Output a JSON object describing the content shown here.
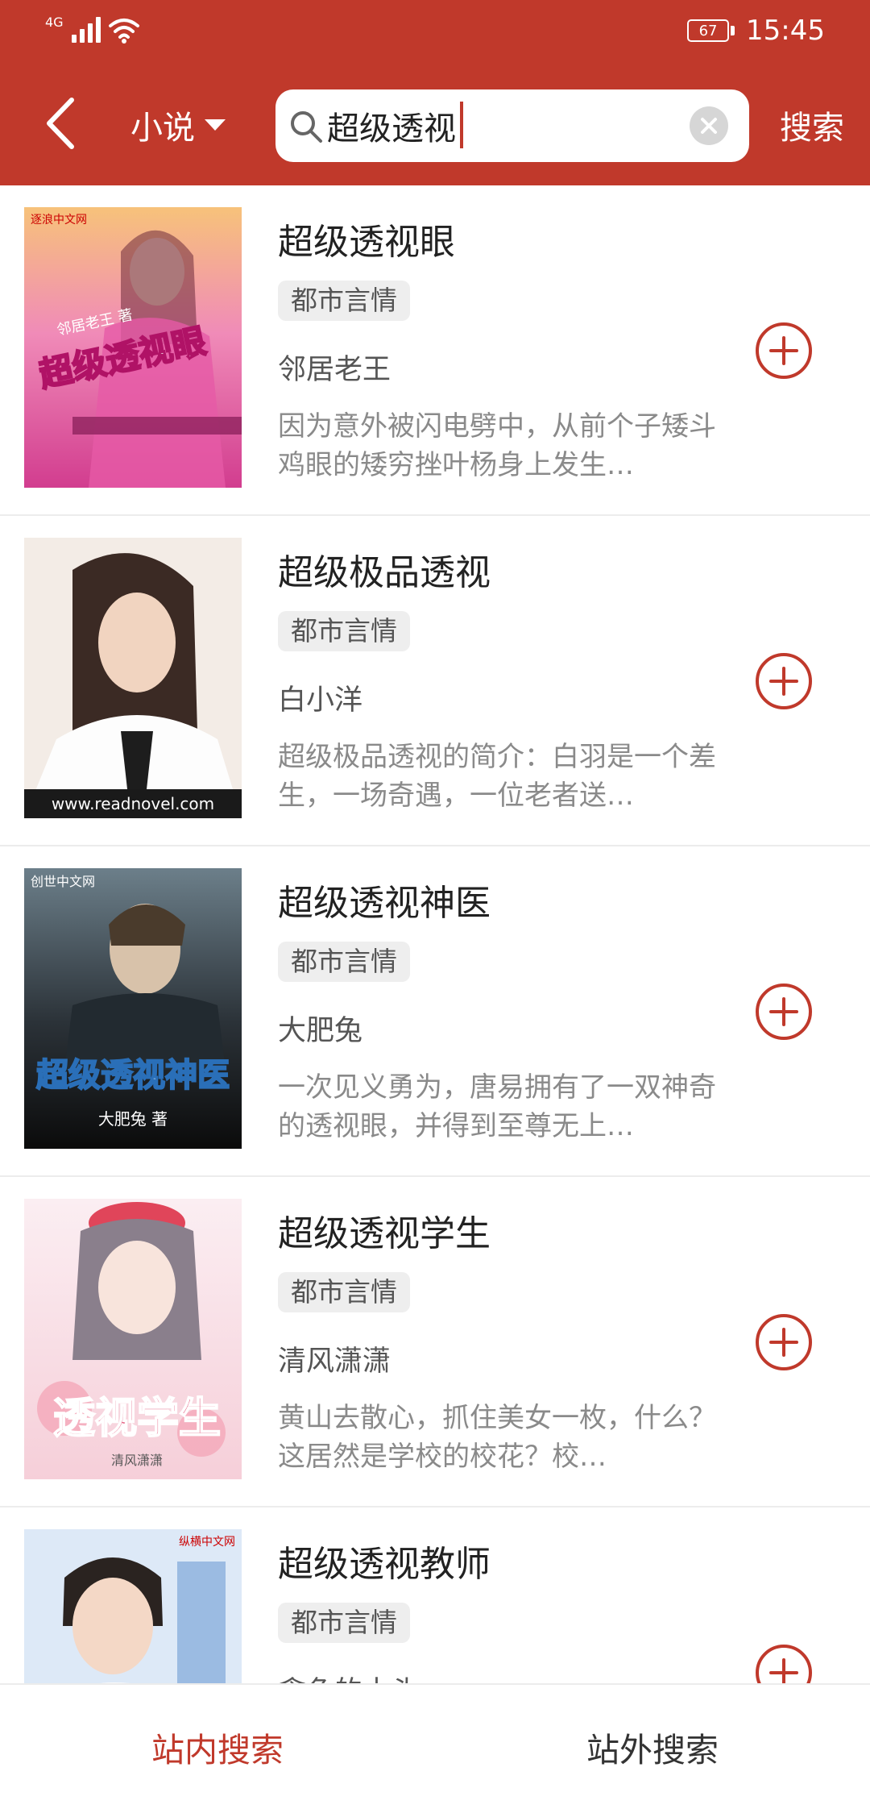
{
  "status_bar": {
    "network": "4G",
    "battery": "67",
    "time": "15:45"
  },
  "header": {
    "back_icon": "back-arrow-icon",
    "category": "小说",
    "search_query": "超级透视",
    "clear_icon": "clear-icon",
    "search_label": "搜索"
  },
  "results": [
    {
      "title": "超级透视眼",
      "tag": "都市言情",
      "author": "邻居老王",
      "desc": "因为意外被闪电劈中，从前个子矮斗鸡眼的矮穷挫叶杨身上发生…",
      "cover_text": "超级透视眼",
      "cover_subtext": "邻居老王 著",
      "cover_brand": "逐浪中文网"
    },
    {
      "title": "超级极品透视",
      "tag": "都市言情",
      "author": "白小洋",
      "desc": "超级极品透视的简介：白羽是一个差生，一场奇遇，一位老者送…",
      "cover_text": "",
      "cover_subtext": "",
      "cover_brand": "www.readnovel.com"
    },
    {
      "title": "超级透视神医",
      "tag": "都市言情",
      "author": "大肥兔",
      "desc": "一次见义勇为，唐易拥有了一双神奇的透视眼，并得到至尊无上…",
      "cover_text": "超级透视神医",
      "cover_subtext": "大肥兔 著",
      "cover_brand": "创世中文网"
    },
    {
      "title": "超级透视学生",
      "tag": "都市言情",
      "author": "清风潇潇",
      "desc": "黄山去散心，抓住美女一枚，什么？这居然是学校的校花？校…",
      "cover_text": "透视学生",
      "cover_subtext": "清风潇潇",
      "cover_brand": ""
    },
    {
      "title": "超级透视教师",
      "tag": "都市言情",
      "author": "贪色的木头",
      "desc": "",
      "cover_text": "",
      "cover_subtext": "",
      "cover_brand": "纵横中文网"
    }
  ],
  "bottom_tabs": [
    {
      "label": "站内搜索",
      "active": true
    },
    {
      "label": "站外搜索",
      "active": false
    }
  ],
  "colors": {
    "accent": "#c0392b",
    "tag_bg": "#eeeeee"
  }
}
